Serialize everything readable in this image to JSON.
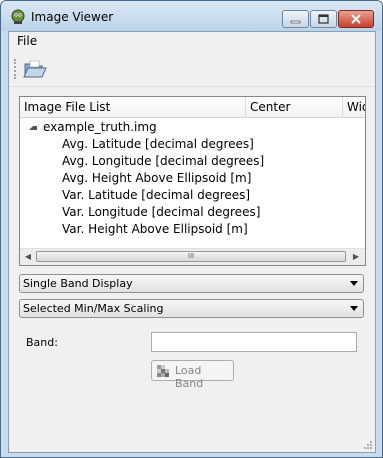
{
  "window": {
    "title": "Image Viewer",
    "controls": {
      "minimize_icon": "minimize-icon",
      "maximize_icon": "maximize-icon",
      "close_icon": "close-icon"
    }
  },
  "menu": {
    "file_label": "File"
  },
  "toolbar": {
    "open_icon": "folder-open-icon"
  },
  "tree": {
    "columns": [
      "Image File List",
      "Center",
      "Wid"
    ],
    "root": "example_truth.img",
    "children": [
      "Avg. Latitude [decimal degrees]",
      "Avg. Longitude [decimal degrees]",
      "Avg. Height Above Ellipsoid [m]",
      "Var. Latitude [decimal degrees]",
      "Var. Longitude [decimal degrees]",
      "Var. Height Above Ellipsoid [m]"
    ],
    "scroll_thumb_grip": "III"
  },
  "display_mode": {
    "selected": "Single Band Display"
  },
  "scaling_mode": {
    "selected": "Selected Min/Max Scaling"
  },
  "band": {
    "label": "Band:",
    "value": ""
  },
  "load_button": {
    "label": "Load Band",
    "enabled": false
  },
  "colors": {
    "title_bar": "#bcd2e8",
    "close_button": "#c7412c",
    "client_bg": "#f0f0f0"
  }
}
